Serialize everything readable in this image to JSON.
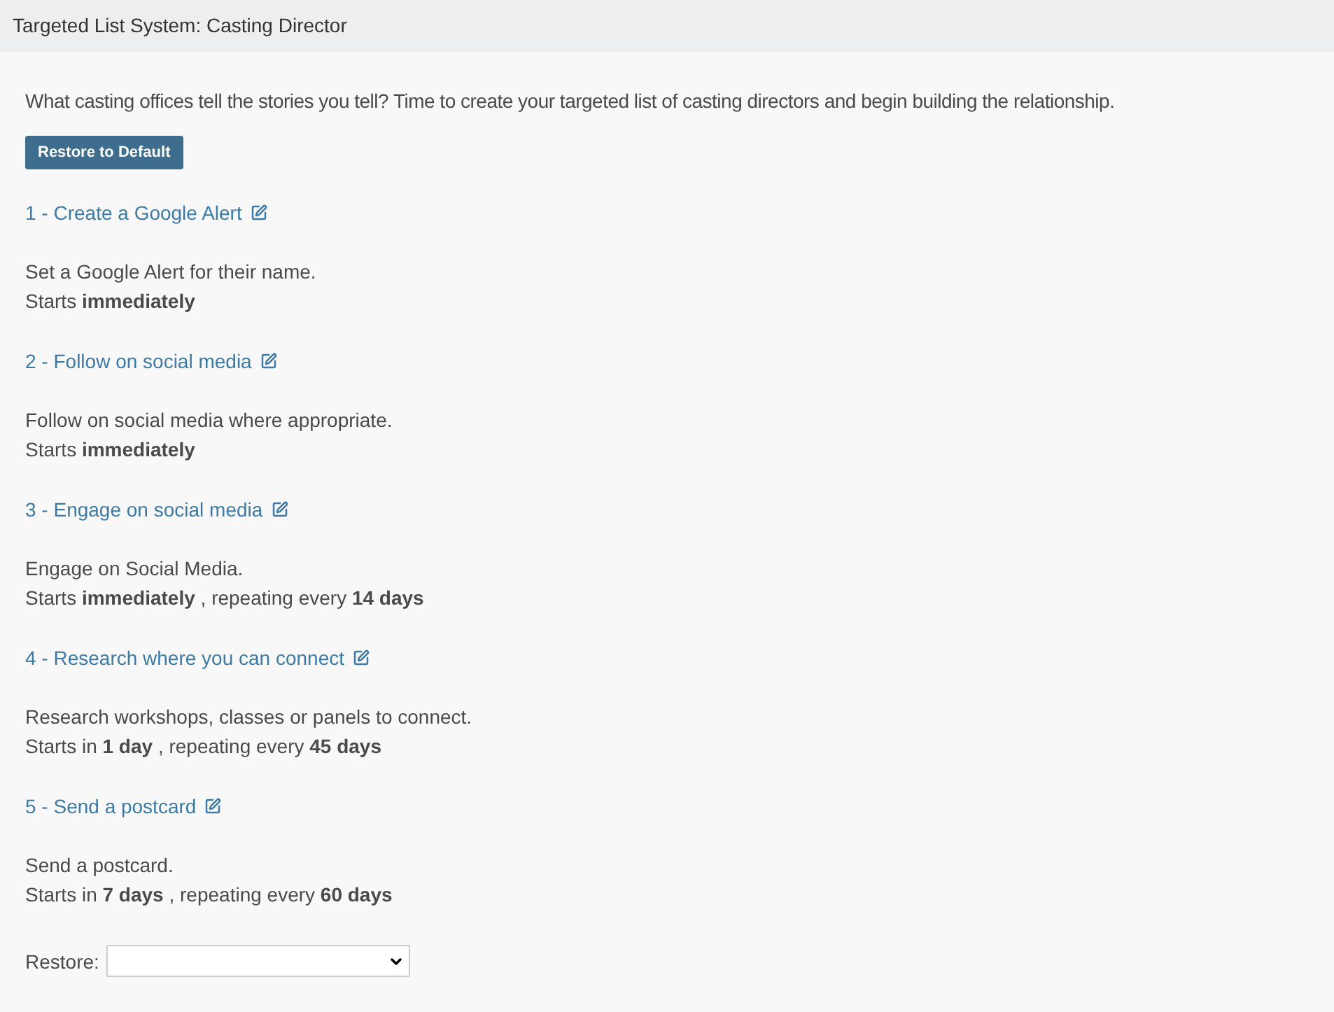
{
  "header": {
    "title": "Targeted List System: Casting Director"
  },
  "intro": "What casting offices tell the stories you tell? Time to create your targeted list of casting directors and begin building the relationship.",
  "restore_button": "Restore to Default",
  "steps": [
    {
      "heading": "1 - Create a Google Alert",
      "description": "Set a Google Alert for their name.",
      "schedule": "Starts **immediately**"
    },
    {
      "heading": "2 - Follow on social media",
      "description": "Follow on social media where appropriate.",
      "schedule": "Starts **immediately**"
    },
    {
      "heading": "3 - Engage on social media",
      "description": "Engage on Social Media.",
      "schedule": "Starts **immediately** , repeating every **14 days**"
    },
    {
      "heading": "4 - Research where you can connect",
      "description": "Research workshops, classes or panels to connect.",
      "schedule": "Starts in **1 day** , repeating every **45 days**"
    },
    {
      "heading": "5 - Send a postcard",
      "description": "Send a postcard.",
      "schedule": "Starts in **7 days** , repeating every **60 days**"
    }
  ],
  "restore": {
    "label": "Restore:"
  }
}
